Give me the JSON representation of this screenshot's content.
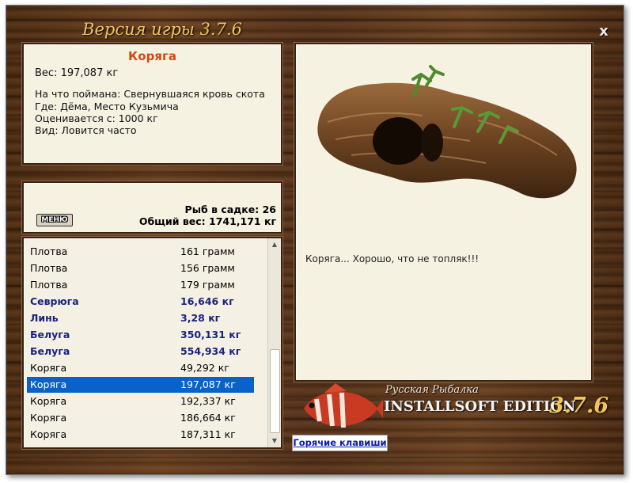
{
  "window": {
    "title": "Версия игры 3.7.6",
    "close_label": "x"
  },
  "catch_info": {
    "name": "Коряга",
    "weight": "Вес: 197,087 кг",
    "bait": "На что поймана: Свернувшаяся кровь скота",
    "location": "Где: Дёма, Место Кузьмича",
    "price": "Оценивается с: 1000 кг",
    "frequency": "Вид: Ловится часто"
  },
  "keeper": {
    "menu_label": "МЕНЮ",
    "count_text": "Рыб в садке: 26",
    "total_text": "Общий вес: 1741,171 кг"
  },
  "catch_list": [
    {
      "name": "Плотва",
      "weight": "161 грамм",
      "big": false,
      "selected": false
    },
    {
      "name": "Плотва",
      "weight": "156 грамм",
      "big": false,
      "selected": false
    },
    {
      "name": "Плотва",
      "weight": "179 грамм",
      "big": false,
      "selected": false
    },
    {
      "name": "Севрюга",
      "weight": "16,646 кг",
      "big": true,
      "selected": false
    },
    {
      "name": "Линь",
      "weight": "3,28 кг",
      "big": true,
      "selected": false
    },
    {
      "name": "Белуга",
      "weight": "350,131 кг",
      "big": true,
      "selected": false
    },
    {
      "name": "Белуга",
      "weight": "554,934 кг",
      "big": true,
      "selected": false
    },
    {
      "name": "Коряга",
      "weight": "49,292 кг",
      "big": false,
      "selected": false
    },
    {
      "name": "Коряга",
      "weight": "197,087 кг",
      "big": false,
      "selected": true
    },
    {
      "name": "Коряга",
      "weight": "192,337 кг",
      "big": false,
      "selected": false
    },
    {
      "name": "Коряга",
      "weight": "186,664 кг",
      "big": false,
      "selected": false
    },
    {
      "name": "Коряга",
      "weight": "187,311 кг",
      "big": false,
      "selected": false
    }
  ],
  "detail": {
    "comment": "Коряга... Хорошо, что не топляк!!!"
  },
  "branding": {
    "subtitle": "Русская Рыбалка",
    "edition": "INSTALLSOFT EDITION",
    "version": "3.7.6"
  },
  "footer": {
    "hotkeys_label": "Горячие клавиши"
  },
  "colors": {
    "selection": "#0a62c8",
    "big_fish": "#19237c",
    "catch_name": "#d24a10",
    "title_gold": "#f2c65a"
  }
}
